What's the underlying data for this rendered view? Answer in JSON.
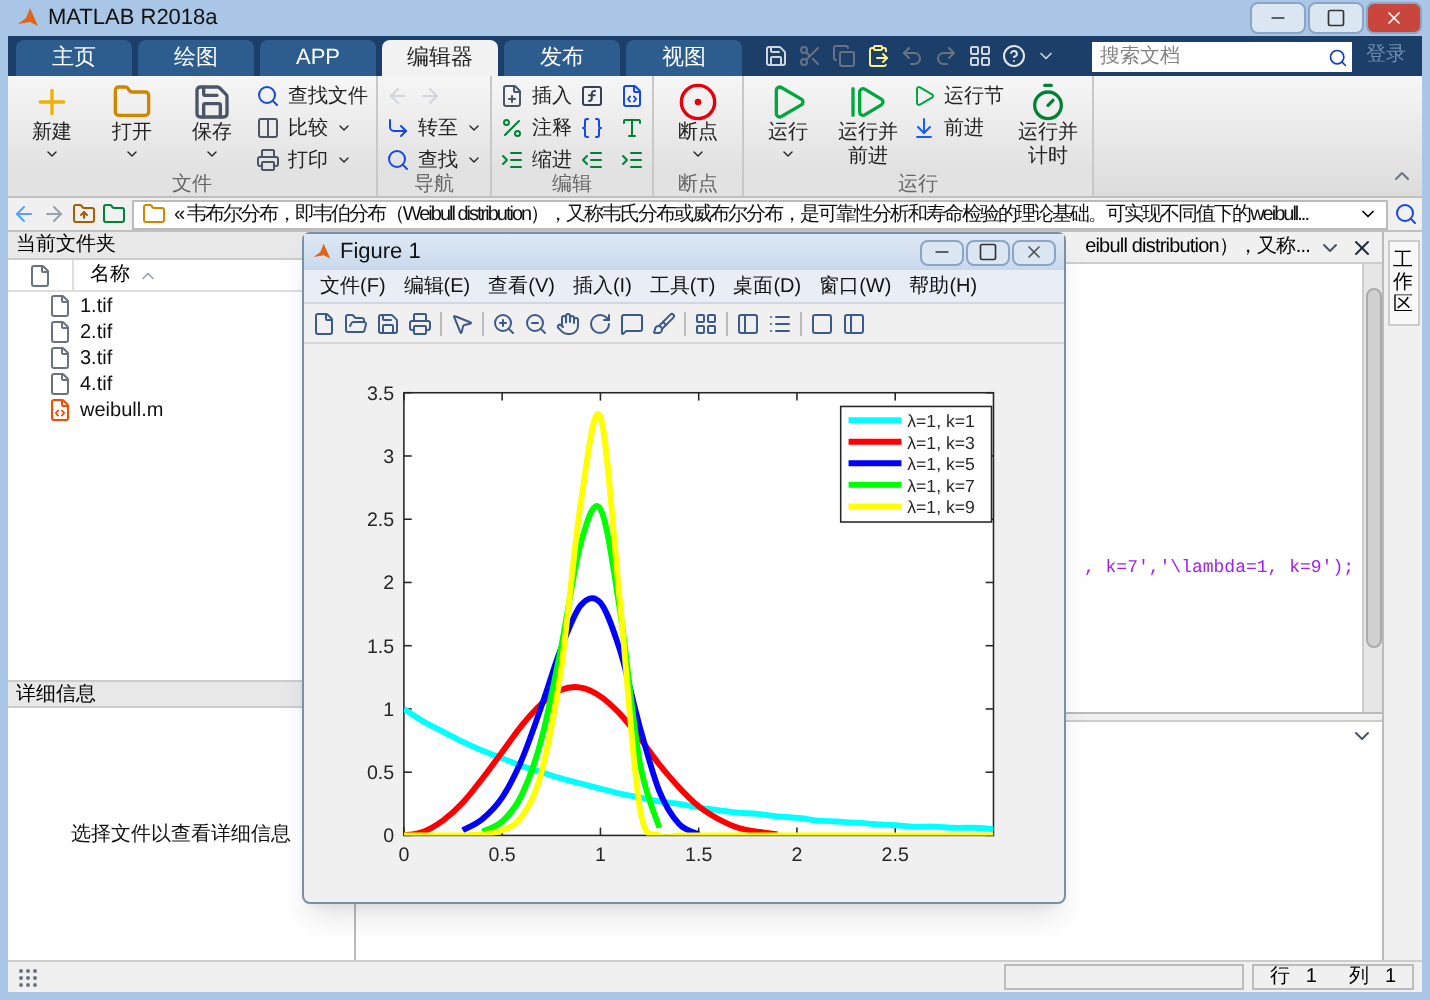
{
  "window": {
    "title": "MATLAB R2018a"
  },
  "tabs": [
    {
      "label": "主页",
      "selected": false
    },
    {
      "label": "绘图",
      "selected": false
    },
    {
      "label": "APP",
      "selected": false
    },
    {
      "label": "编辑器",
      "selected": true
    },
    {
      "label": "发布",
      "selected": false
    },
    {
      "label": "视图",
      "selected": false
    }
  ],
  "search": {
    "placeholder": "搜索文档"
  },
  "login": "登录",
  "ribbon": [
    {
      "label": "文件",
      "buttons": [
        {
          "kind": "large",
          "label": "新建"
        },
        {
          "kind": "large",
          "label": "打开"
        },
        {
          "kind": "large",
          "label": "保存"
        },
        {
          "kind": "small",
          "label": "查找文件"
        },
        {
          "kind": "small",
          "label": "比较"
        },
        {
          "kind": "small",
          "label": "打印"
        }
      ]
    },
    {
      "label": "导航",
      "buttons": [
        {
          "kind": "small",
          "label": "转至"
        },
        {
          "kind": "small",
          "label": "查找"
        }
      ]
    },
    {
      "label": "编辑",
      "buttons": [
        {
          "kind": "small",
          "label": "插入"
        },
        {
          "kind": "small",
          "label": "注释"
        },
        {
          "kind": "small",
          "label": "缩进"
        }
      ]
    },
    {
      "label": "断点",
      "buttons": [
        {
          "kind": "large",
          "label": "断点"
        }
      ]
    },
    {
      "label": "运行",
      "buttons": [
        {
          "kind": "large",
          "label": "运行"
        },
        {
          "kind": "large",
          "label": "运行并前进"
        },
        {
          "kind": "small",
          "label": "运行节"
        },
        {
          "kind": "small",
          "label": "前进"
        },
        {
          "kind": "large",
          "label": "运行并计时"
        }
      ]
    }
  ],
  "address": {
    "path": "« 韦布尔分布，即韦伯分布（Weibull distribution），又称韦氏分布或威布尔分布，是可靠性分析和寿命检验的理论基础。可实现不同值下的weibull..."
  },
  "current_folder": {
    "title": "当前文件夹",
    "column": "名称",
    "files": [
      {
        "name": "1.tif",
        "kind": "file"
      },
      {
        "name": "2.tif",
        "kind": "file"
      },
      {
        "name": "3.tif",
        "kind": "file"
      },
      {
        "name": "4.tif",
        "kind": "file"
      },
      {
        "name": "weibull.m",
        "kind": "script"
      }
    ]
  },
  "details": {
    "title": "详细信息",
    "message": "选择文件以查看详细信息"
  },
  "editor": {
    "tab": "eibull distribution），又称...",
    "code": ", k=7','\\lambda=1, k=9');"
  },
  "workspace": {
    "title": "工作区"
  },
  "status_bar": {
    "row_label": "行",
    "row": "1",
    "col_label": "列",
    "col": "1"
  },
  "figure": {
    "title": "Figure 1",
    "menus": [
      "文件(F)",
      "编辑(E)",
      "查看(V)",
      "插入(I)",
      "工具(T)",
      "桌面(D)",
      "窗口(W)",
      "帮助(H)"
    ],
    "chart_data": {
      "type": "line",
      "legend": "top right",
      "xlim": [
        0,
        3
      ],
      "ylim": [
        0,
        3.5
      ],
      "xticks": [
        0,
        0.5,
        1,
        1.5,
        2,
        2.5
      ],
      "yticks": [
        0,
        0.5,
        1,
        1.5,
        2,
        2.5,
        3,
        3.5
      ],
      "x": [
        0,
        0.1,
        0.2,
        0.3,
        0.4,
        0.5,
        0.6,
        0.7,
        0.8,
        0.9,
        1.0,
        1.1,
        1.2,
        1.3,
        1.4,
        1.5,
        1.6,
        1.7,
        1.8,
        1.9,
        2.0,
        2.1,
        2.2,
        2.3,
        2.4,
        2.5,
        2.6,
        2.7,
        2.8,
        2.9,
        3.0
      ],
      "series": [
        {
          "name": "λ=1, k=1",
          "color": "#00ffff",
          "values": [
            1,
            0.9,
            0.82,
            0.74,
            0.67,
            0.61,
            0.55,
            0.5,
            0.45,
            0.41,
            0.37,
            0.33,
            0.3,
            0.27,
            0.25,
            0.22,
            0.2,
            0.18,
            0.17,
            0.15,
            0.14,
            0.12,
            0.11,
            0.1,
            0.09,
            0.08,
            0.07,
            0.07,
            0.06,
            0.06,
            0.05
          ]
        },
        {
          "name": "λ=1, k=3",
          "color": "#ff0000",
          "values": [
            0,
            0.03,
            0.12,
            0.26,
            0.45,
            0.66,
            0.87,
            1.04,
            1.15,
            1.17,
            1.1,
            0.96,
            0.77,
            0.56,
            0.38,
            0.23,
            0.13,
            0.06,
            0.03,
            0.01,
            null,
            null,
            null,
            null,
            null,
            null,
            null,
            null,
            null,
            null,
            null
          ]
        },
        {
          "name": "λ=1, k=5",
          "color": "#0000ff",
          "values": [
            null,
            null,
            null,
            0.04,
            0.13,
            0.3,
            0.6,
            1.02,
            1.48,
            1.82,
            1.84,
            1.46,
            0.86,
            0.35,
            0.09,
            0.01,
            null,
            null,
            null,
            null,
            null,
            null,
            null,
            null,
            null,
            null,
            null,
            null,
            null,
            null,
            null
          ]
        },
        {
          "name": "λ=1, k=7",
          "color": "#00ff00",
          "values": [
            null,
            null,
            null,
            null,
            0.03,
            0.11,
            0.32,
            0.76,
            1.49,
            2.31,
            2.58,
            1.77,
            0.58,
            0.06,
            null,
            null,
            null,
            null,
            null,
            null,
            null,
            null,
            null,
            null,
            null,
            null,
            null,
            null,
            null,
            null,
            null
          ]
        },
        {
          "name": "λ=1, k=9",
          "color": "#ffff00",
          "values": [
            0,
            0,
            0,
            0,
            0.01,
            0.04,
            0.15,
            0.5,
            1.32,
            2.63,
            3.31,
            1.83,
            0.22,
            0,
            0,
            0,
            0,
            0,
            0,
            0,
            0,
            0,
            0,
            0,
            0,
            0,
            0,
            0,
            0,
            0,
            0
          ]
        }
      ]
    }
  }
}
